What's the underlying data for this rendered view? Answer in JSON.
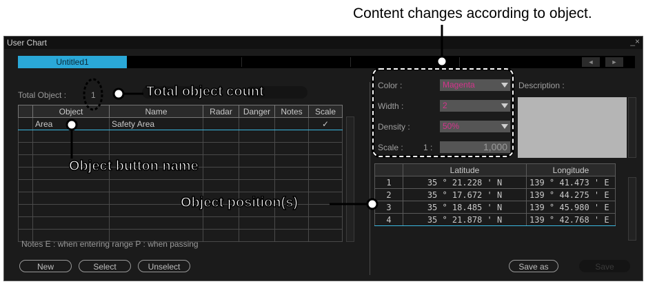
{
  "caption_top": "Content changes according to object.",
  "window": {
    "title": "User Chart",
    "close": "_×"
  },
  "tabs": {
    "active": "Untitled1",
    "prev": "◄",
    "next": "►"
  },
  "left": {
    "total_label": "Total Object :",
    "total_value": "1",
    "columns": [
      "Object",
      "Name",
      "Radar",
      "Danger",
      "Notes",
      "Scale"
    ],
    "rows": [
      {
        "object": "Area",
        "name": "Safety Area",
        "radar": "",
        "danger": "",
        "notes": "",
        "scale": "✓"
      }
    ],
    "notes_text": "Notes E : when entering range  P : when passing"
  },
  "right": {
    "color_label": "Color :",
    "color_value": "Magenta",
    "width_label": "Width :",
    "width_value": "2",
    "density_label": "Density :",
    "density_value": "50%",
    "scale_label": "Scale :",
    "scale_prefix": "1 :",
    "scale_value": "1,000",
    "description_label": "Description :",
    "pos_columns": [
      "Latitude",
      "Longitude"
    ],
    "positions": [
      {
        "n": "1",
        "lat": "35 ° 21.228 ' N",
        "lon": "139 ° 41.473 ' E"
      },
      {
        "n": "2",
        "lat": "35 ° 17.672 ' N",
        "lon": "139 ° 44.275 ' E"
      },
      {
        "n": "3",
        "lat": "35 ° 18.485 ' N",
        "lon": "139 ° 45.980 ' E"
      },
      {
        "n": "4",
        "lat": "35 ° 21.878 ' N",
        "lon": "139 ° 42.768 ' E"
      }
    ]
  },
  "buttons": {
    "new": "New",
    "select": "Select",
    "unselect": "Unselect",
    "save_as": "Save as",
    "save": "Save"
  },
  "callouts": {
    "total_count": "Total object count",
    "object_button": "Object button name",
    "positions": "Object position(s)"
  },
  "colors": {
    "accent": "#2aa8d8",
    "value_magenta": "#d4348c"
  }
}
